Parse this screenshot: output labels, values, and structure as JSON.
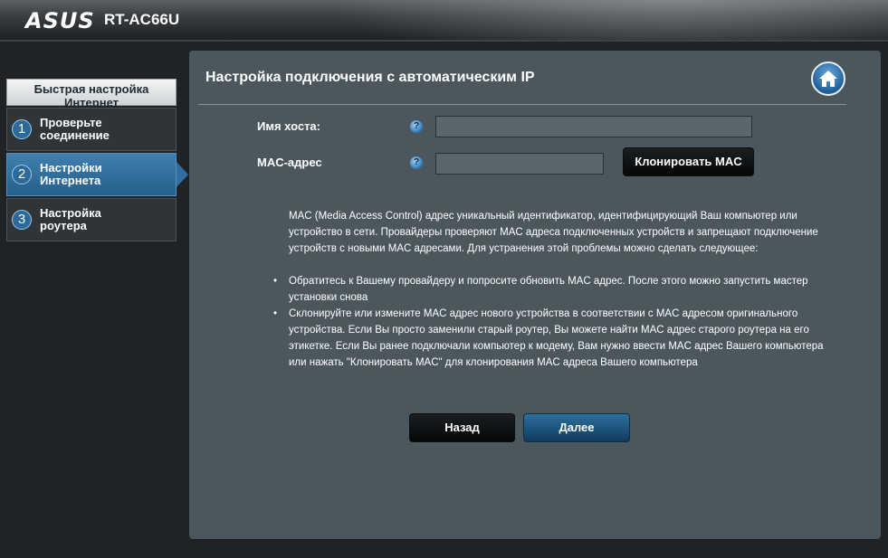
{
  "header": {
    "brand": "ASUS",
    "model": "RT-AC66U"
  },
  "sidebar": {
    "title": "Быстрая настройка Интернет",
    "steps": [
      {
        "num": "1",
        "label": "Проверьте соединение",
        "active": false
      },
      {
        "num": "2",
        "label": "Настройки Интернета",
        "active": true
      },
      {
        "num": "3",
        "label": "Настройка роутера",
        "active": false
      }
    ]
  },
  "panel": {
    "title": "Настройка подключения с автоматическим IP",
    "home_icon": "home-icon",
    "fields": {
      "hostname_label": "Имя хоста:",
      "hostname_value": "",
      "mac_label": "MAC-адрес",
      "mac_value": "",
      "help_icon": "?"
    },
    "clone_mac_button": "Клонировать MAC",
    "description": "MAC (Media Access Control) адрес уникальный идентификатор, идентифицирующий Ваш компьютер или устройство в сети. Провайдеры проверяют MAC адреса подключенных устройств и запрещают подключение устройств с новыми MAC адресами. Для устранения этой проблемы можно сделать следующее:",
    "bullets": [
      "Обратитесь к Вашему провайдеру и попросите обновить MAC адрес. После этого можно запустить мастер установки снова",
      "Склонируйте или измените MAC адрес нового устройства в соответствии с MAC адресом оригинального устройства. Если Вы просто заменили старый роутер, Вы можете найти MAC адрес старого роутера на его этикетке. Если Вы ранее подключали компьютер к модему, Вам нужно ввести MAC адрес Вашего компьютера или нажать \"Клонировать MAC\" для клонирования MAC адреса Вашего компьютера"
    ],
    "back_button": "Назад",
    "next_button": "Далее"
  },
  "colors": {
    "panel_bg": "#4b575c",
    "active_step": "#2f6e9e",
    "next_button": "#1e5a86"
  }
}
